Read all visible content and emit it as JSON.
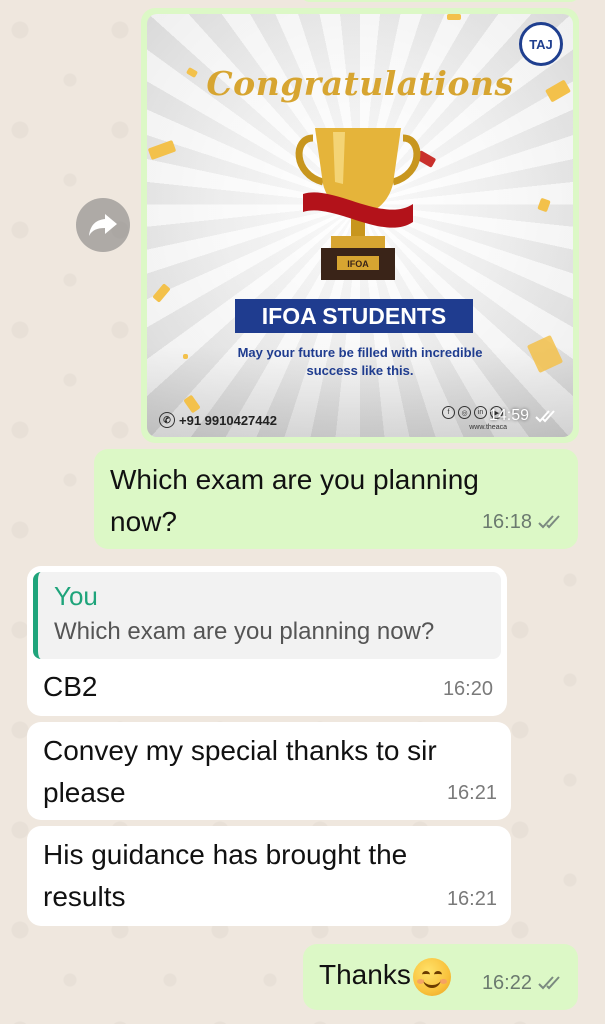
{
  "poster": {
    "heading": "Congratulations",
    "logo": "TAJ",
    "trophy_plate": "IFOA",
    "banner": "IFOA STUDENTS",
    "wish_line1": "May your future be filled with incredible",
    "wish_line2": "success like this.",
    "phone": "+91 9910427442",
    "website": "www.theaca",
    "time": "14:59"
  },
  "messages": [
    {
      "direction": "out",
      "text_line1": "Which exam are you planning",
      "text_line2": "now?",
      "time": "16:18",
      "status": "read"
    },
    {
      "direction": "in",
      "quote_author": "You",
      "quote_text": "Which exam are you planning now?",
      "text": "CB2",
      "time": "16:20"
    },
    {
      "direction": "in",
      "text_line1": "Convey my special thanks to sir",
      "text_line2": "please",
      "time": "16:21"
    },
    {
      "direction": "in",
      "text_line1": "His guidance has brought the",
      "text_line2": "results",
      "time": "16:21"
    },
    {
      "direction": "out",
      "text": "Thanks",
      "emoji": "smiling-face-with-smiling-eyes",
      "time": "16:22",
      "status": "read"
    }
  ],
  "colors": {
    "outgoing_bubble": "#dcf8c6",
    "incoming_bubble": "#ffffff",
    "wallpaper": "#efe7de",
    "quote_accent": "#1fa47b",
    "poster_blue": "#1f3c8f",
    "poster_gold": "#d7a531"
  },
  "icons": [
    "forward-icon",
    "double-check-icon",
    "phone-icon",
    "facebook-icon",
    "instagram-icon",
    "linkedin-icon",
    "youtube-icon"
  ]
}
